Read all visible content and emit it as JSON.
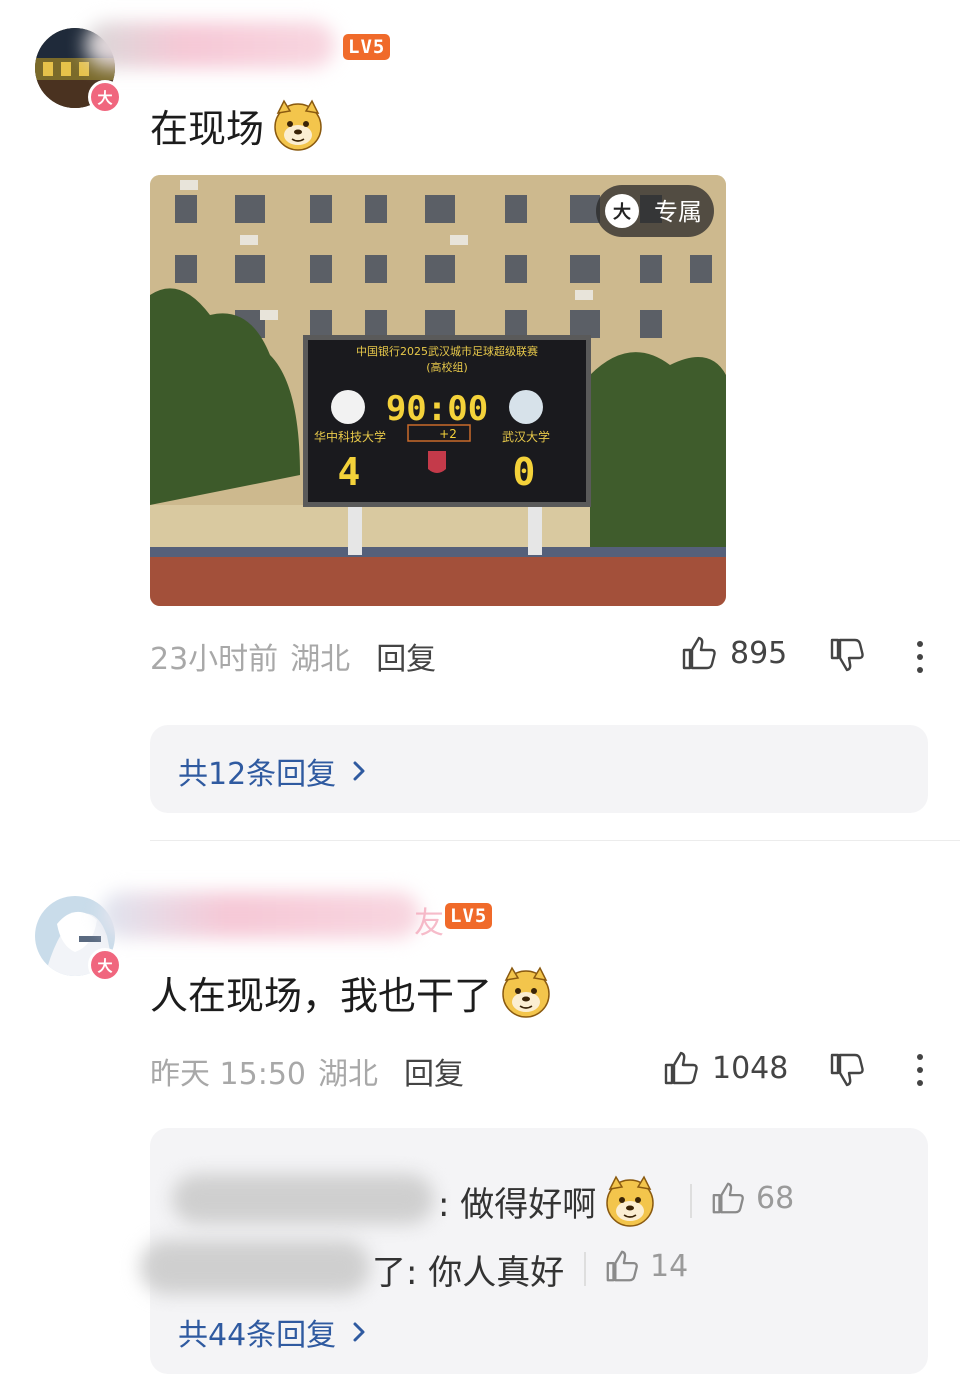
{
  "comments": [
    {
      "level": "LV5",
      "avatar_badge": "大",
      "text": "在现场",
      "image": {
        "exclusive_badge": "专属",
        "exclusive_icon": "大",
        "scoreboard": {
          "title_line1": "中国银行2025武汉城市足球超级联赛",
          "title_line2": "(高校组)",
          "clock": "90:00",
          "added_time": "+2",
          "home_team": "华中科技大学",
          "away_team": "武汉大学",
          "home_score": "4",
          "away_score": "0"
        }
      },
      "time": "23小时前",
      "location": "湖北",
      "reply_label": "回复",
      "likes": "895",
      "replies_link": "共12条回复"
    },
    {
      "level": "LV5",
      "avatar_badge": "大",
      "name_partial": "友",
      "text": "人在现场，我也干了",
      "time": "昨天 15:50",
      "location": "湖北",
      "reply_label": "回复",
      "likes": "1048",
      "sub_replies": [
        {
          "text": ": 做得好啊",
          "likes": "68"
        },
        {
          "text": "了: 你人真好",
          "likes": "14"
        }
      ],
      "replies_link": "共44条回复"
    }
  ],
  "colors": {
    "level_badge": "#f06a2a",
    "link": "#2f5aa0",
    "badge_pink": "#f0667e"
  }
}
